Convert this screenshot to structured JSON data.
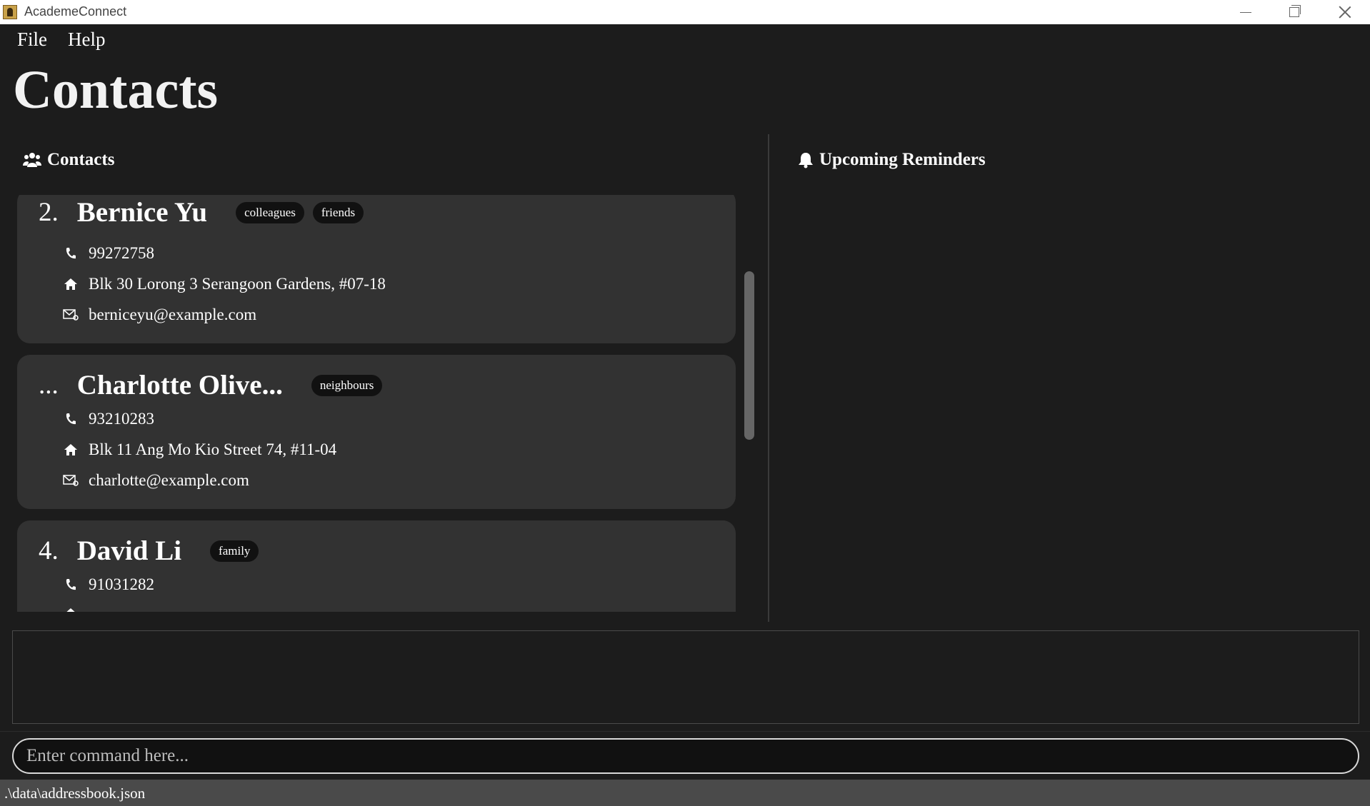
{
  "window": {
    "title": "AcademeConnect"
  },
  "menu": {
    "file": "File",
    "help": "Help"
  },
  "page": {
    "title": "Contacts"
  },
  "panels": {
    "contacts_title": "Contacts",
    "reminders_title": "Upcoming Reminders"
  },
  "contacts": [
    {
      "index": "2.",
      "name": "Bernice Yu",
      "tags": [
        "colleagues",
        "friends"
      ],
      "phone": "99272758",
      "address": "Blk 30 Lorong 3 Serangoon Gardens, #07-18",
      "email": "berniceyu@example.com"
    },
    {
      "index": "...",
      "name": "Charlotte Olive...",
      "tags": [
        "neighbours"
      ],
      "phone": "93210283",
      "address": "Blk 11 Ang Mo Kio Street 74, #11-04",
      "email": "charlotte@example.com"
    },
    {
      "index": "4.",
      "name": "David Li",
      "tags": [
        "family"
      ],
      "phone": "91031282"
    }
  ],
  "command": {
    "placeholder": "Enter command here..."
  },
  "status": {
    "path": ".\\data\\addressbook.json"
  },
  "icons": {
    "phone": "phone-icon",
    "address": "home-icon",
    "email": "mail-icon",
    "contacts": "people-icon",
    "reminders": "bell-icon"
  }
}
